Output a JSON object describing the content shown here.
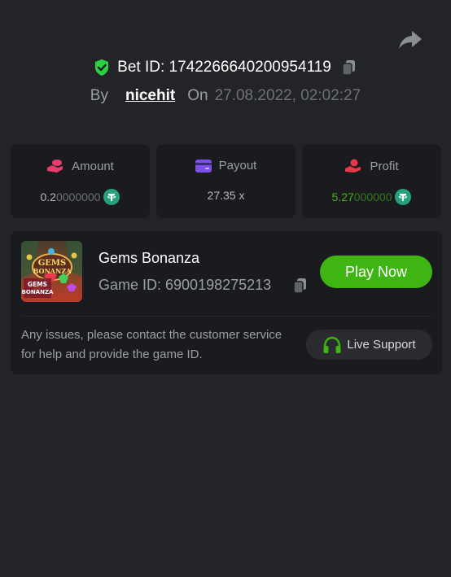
{
  "bet": {
    "id_label": "Bet ID: 1742266640200954119",
    "by_label": "By",
    "username": "nicehit",
    "on_label": "On",
    "datetime": "27.08.2022, 02:02:27"
  },
  "stats": {
    "amount": {
      "label": "Amount",
      "value_main": "0.2",
      "value_dim": "0000000"
    },
    "payout": {
      "label": "Payout",
      "value": "27.35 x"
    },
    "profit": {
      "label": "Profit",
      "value_main": "5.27",
      "value_dim": "000000"
    }
  },
  "game": {
    "title": "Gems Bonanza",
    "id_label": "Game ID: 6900198275213",
    "thumb_text_1": "GEMS",
    "thumb_text_2": "BONANZA",
    "play_label": "Play Now",
    "help_text": "Any issues, please contact the customer service for help and provide the game ID.",
    "support_label": "Live Support"
  },
  "colors": {
    "background": "#232427",
    "card": "#1a1b1e",
    "accent_green": "#3fb514",
    "profit_green": "#3fb514",
    "amount_icon": "#e83e6c",
    "payout_icon": "#7b4fe8",
    "profit_icon": "#e8394a",
    "shield": "#2bd13f",
    "tether": "#26a17b"
  },
  "icons": {
    "share": "share-arrow-icon",
    "shield": "shield-check-icon",
    "copy": "copy-icon",
    "amount": "coins-hand-icon",
    "payout": "card-icon",
    "profit": "hand-coin-icon",
    "tether": "tether-coin-icon",
    "headset": "headset-icon"
  }
}
